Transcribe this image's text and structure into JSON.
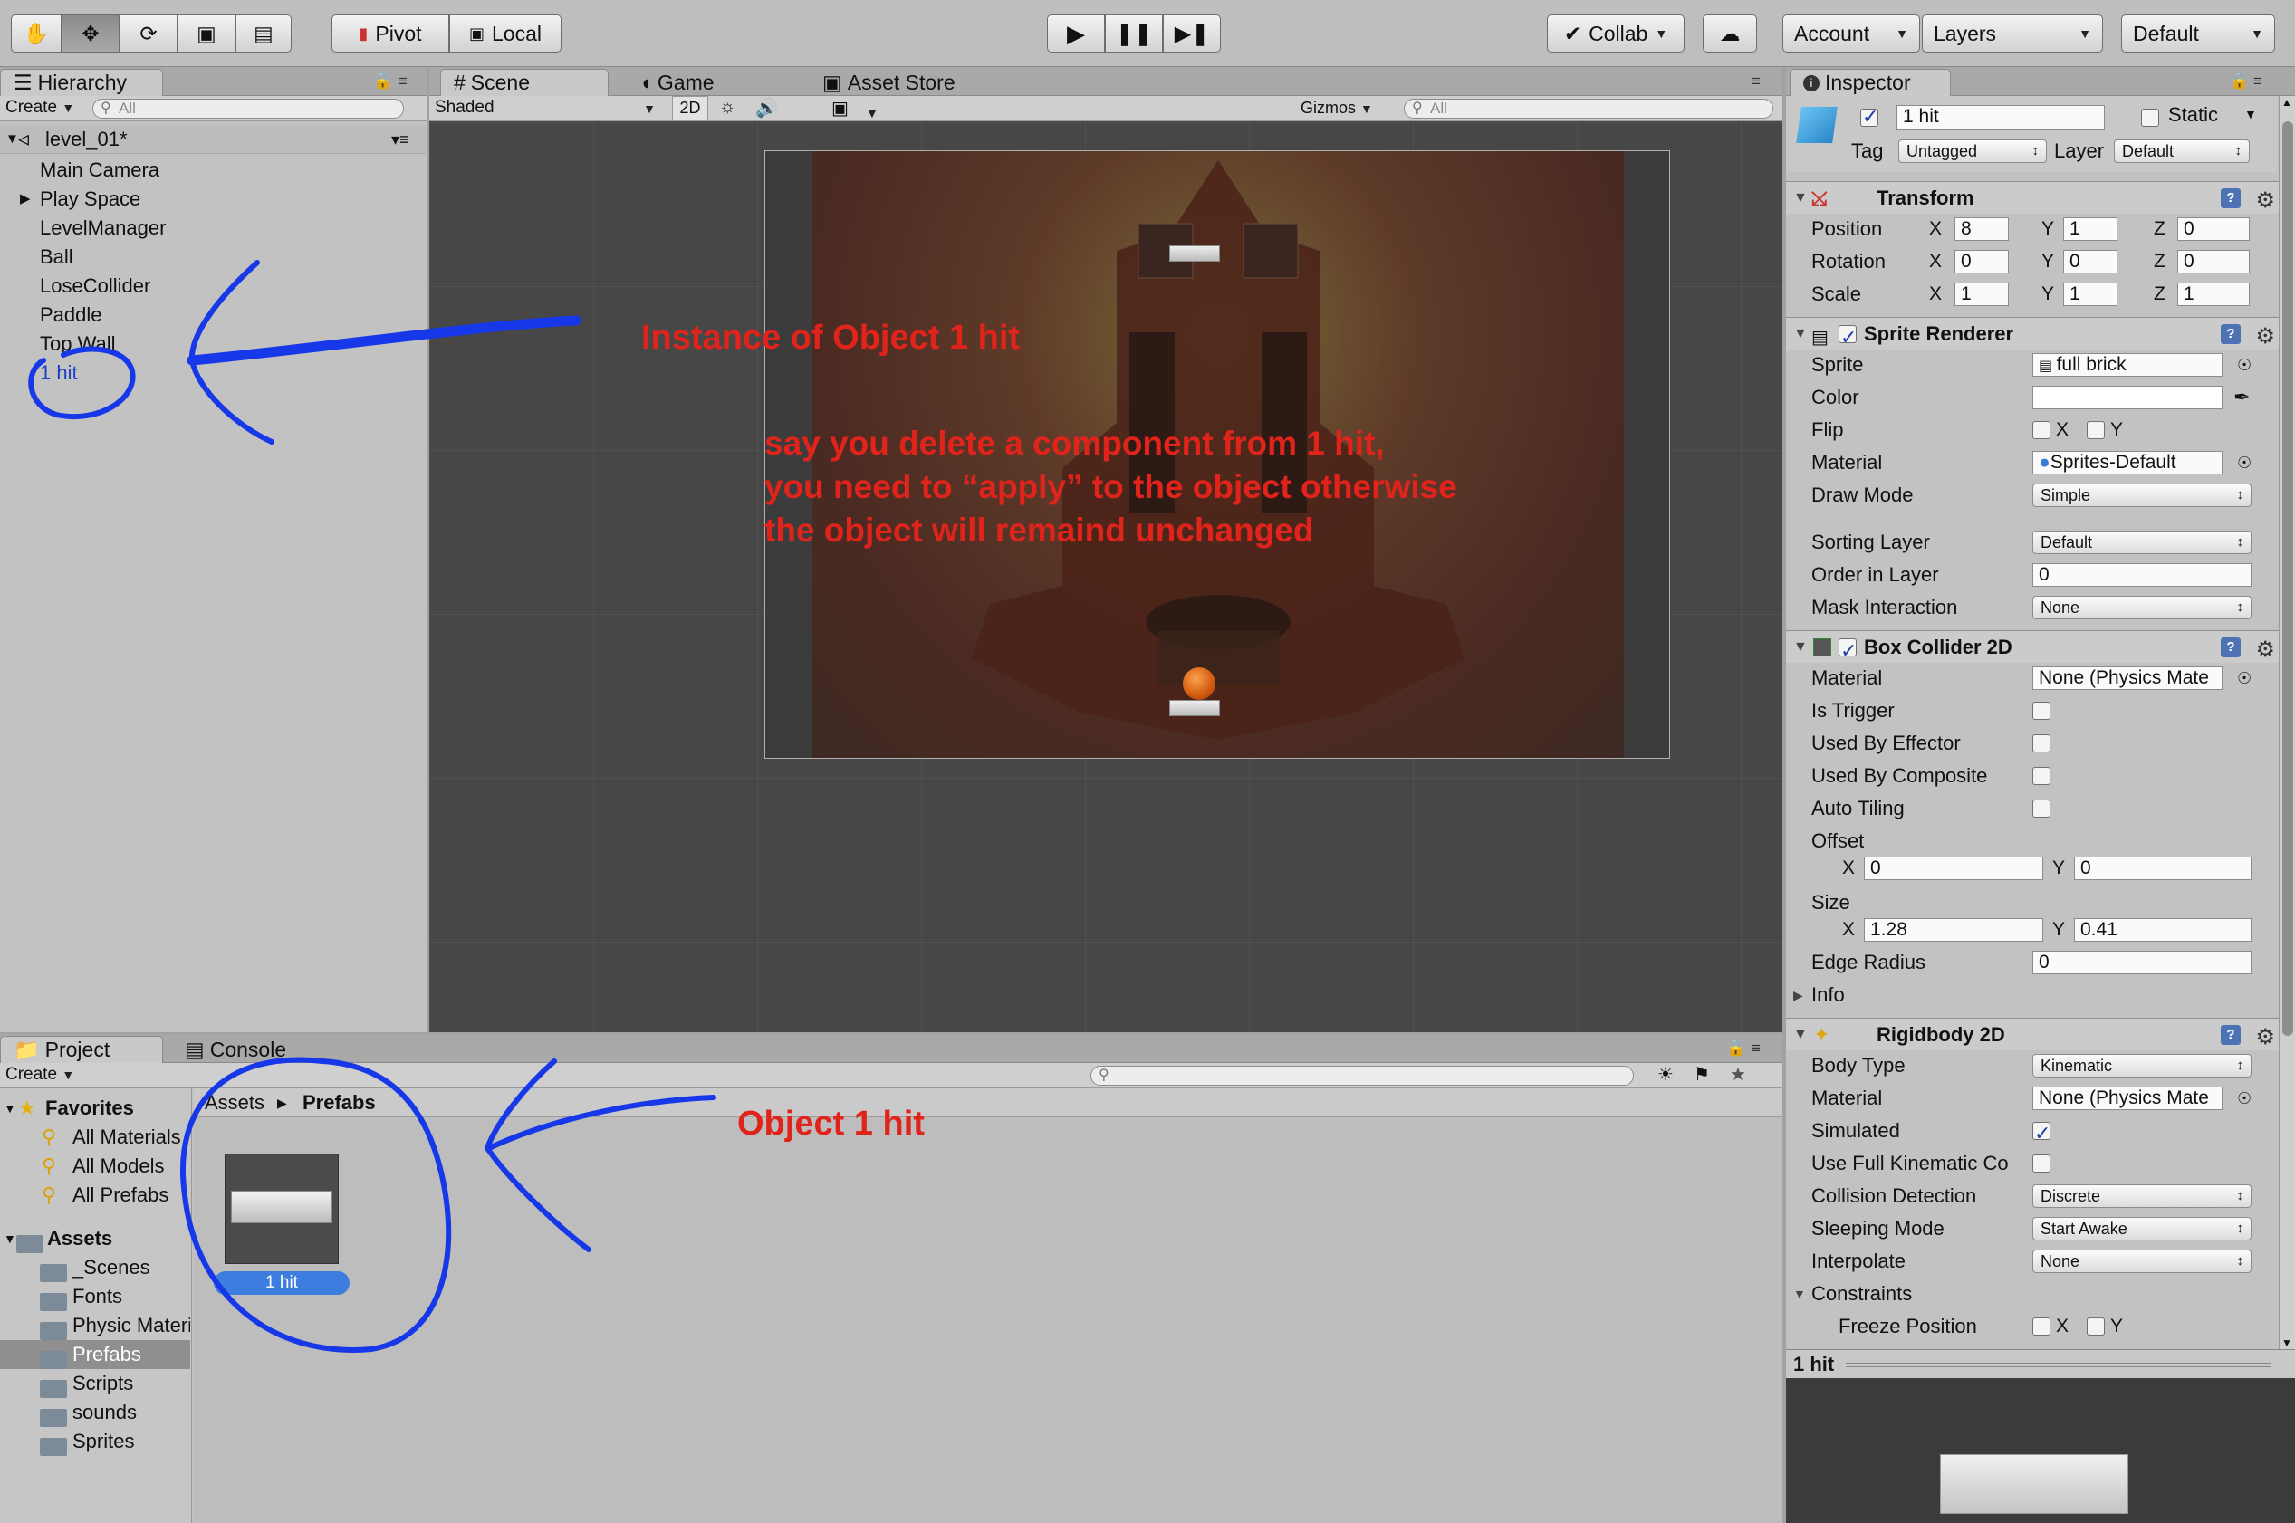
{
  "toolbar": {
    "pivot": "Pivot",
    "local": "Local",
    "collab": "Collab",
    "account": "Account",
    "layers": "Layers",
    "layout": "Default"
  },
  "hierarchy": {
    "tab": "Hierarchy",
    "create": "Create",
    "search_placeholder": "All",
    "scene": "level_01*",
    "items": [
      "Main Camera",
      "Play Space",
      "LevelManager",
      "Ball",
      "LoseCollider",
      "Paddle",
      "Top Wall",
      "1 hit"
    ]
  },
  "scene": {
    "tabs": [
      "Scene",
      "Game",
      "Asset Store"
    ],
    "shading": "Shaded",
    "mode_2d": "2D",
    "gizmos": "Gizmos",
    "search_placeholder": "All"
  },
  "project": {
    "tabs": [
      "Project",
      "Console"
    ],
    "create": "Create",
    "favorites_label": "Favorites",
    "favorites": [
      "All Materials",
      "All Models",
      "All Prefabs"
    ],
    "assets_label": "Assets",
    "folders": [
      "_Scenes",
      "Fonts",
      "Physic Materials",
      "Prefabs",
      "Scripts",
      "sounds",
      "Sprites"
    ],
    "breadcrumb": [
      "Assets",
      "Prefabs"
    ],
    "asset_name": "1 hit"
  },
  "inspector": {
    "tab": "Inspector",
    "object_name": "1 hit",
    "static_label": "Static",
    "tag_label": "Tag",
    "tag_value": "Untagged",
    "layer_label": "Layer",
    "layer_value": "Default",
    "transform": {
      "title": "Transform",
      "position_label": "Position",
      "position": [
        "8",
        "1",
        "0"
      ],
      "rotation_label": "Rotation",
      "rotation": [
        "0",
        "0",
        "0"
      ],
      "scale_label": "Scale",
      "scale": [
        "1",
        "1",
        "1"
      ]
    },
    "sprite_renderer": {
      "title": "Sprite Renderer",
      "sprite_label": "Sprite",
      "sprite": "full brick",
      "color_label": "Color",
      "flip_label": "Flip",
      "material_label": "Material",
      "material": "Sprites-Default",
      "draw_mode_label": "Draw Mode",
      "draw_mode": "Simple",
      "sorting_layer_label": "Sorting Layer",
      "sorting_layer": "Default",
      "order_label": "Order in Layer",
      "order": "0",
      "mask_label": "Mask Interaction",
      "mask": "None"
    },
    "box_collider": {
      "title": "Box Collider 2D",
      "material_label": "Material",
      "material": "None (Physics Mate",
      "is_trigger": "Is Trigger",
      "used_by_effector": "Used By Effector",
      "used_by_composite": "Used By Composite",
      "auto_tiling": "Auto Tiling",
      "offset_label": "Offset",
      "offset": [
        "0",
        "0"
      ],
      "size_label": "Size",
      "size": [
        "1.28",
        "0.41"
      ],
      "edge_radius_label": "Edge Radius",
      "edge_radius": "0",
      "info": "Info"
    },
    "rigidbody": {
      "title": "Rigidbody 2D",
      "body_type_label": "Body Type",
      "body_type": "Kinematic",
      "material_label": "Material",
      "material": "None (Physics Mate",
      "simulated": "Simulated",
      "full_kinematic": "Use Full Kinematic Co",
      "collision_label": "Collision Detection",
      "collision": "Discrete",
      "sleeping_label": "Sleeping Mode",
      "sleeping": "Start Awake",
      "interpolate_label": "Interpolate",
      "interpolate": "None",
      "constraints": "Constraints",
      "freeze_position": "Freeze Position"
    },
    "axis": {
      "x": "X",
      "y": "Y",
      "z": "Z"
    },
    "preview_title": "1 hit"
  },
  "annotations": {
    "instance": "Instance of Object 1 hit",
    "note_lines": [
      "say you delete a component from 1 hit,",
      "you need to “apply” to the object otherwise",
      "the object will remaind unchanged"
    ],
    "object": "Object 1 hit"
  },
  "colors": {
    "annotation_red": "#e0241b",
    "marker_blue": "#1638e8",
    "selection_blue": "#3d7ddf"
  }
}
